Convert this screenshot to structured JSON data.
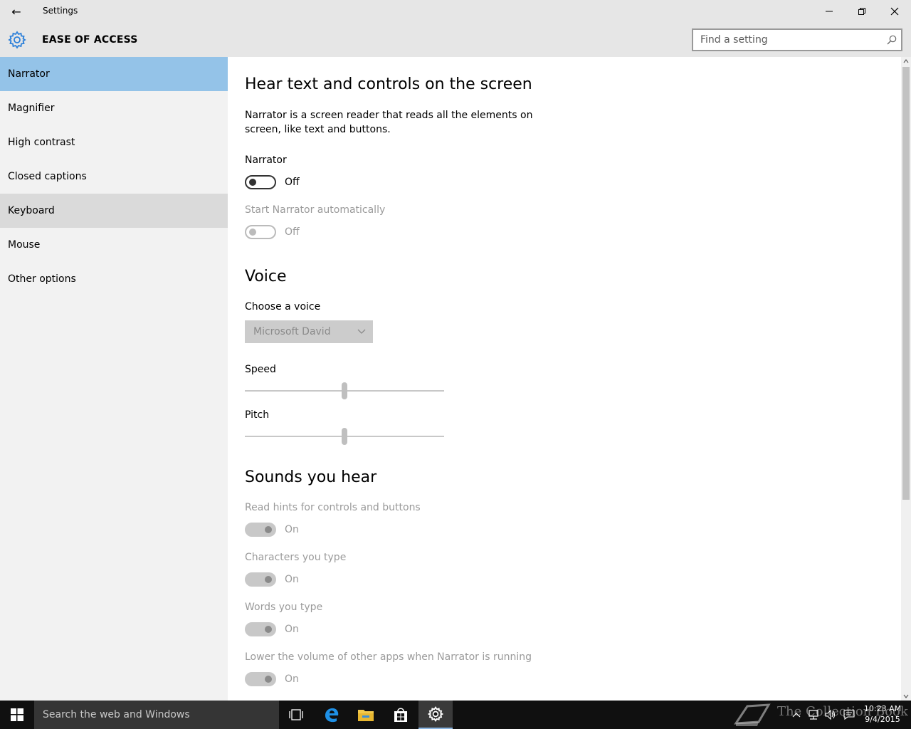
{
  "window": {
    "title": "Settings",
    "back_glyph": "←",
    "controls": {
      "minimize": "minimize-icon",
      "maximize": "restore-icon",
      "close": "close-icon"
    }
  },
  "header": {
    "title": "EASE OF ACCESS",
    "icon": "gear-icon",
    "accent": "#2b7fd9",
    "search_placeholder": "Find a setting"
  },
  "sidebar": {
    "selected_color": "#94c3e8",
    "items": [
      {
        "label": "Narrator",
        "state": "selected"
      },
      {
        "label": "Magnifier",
        "state": "normal"
      },
      {
        "label": "High contrast",
        "state": "normal"
      },
      {
        "label": "Closed captions",
        "state": "normal"
      },
      {
        "label": "Keyboard",
        "state": "hover"
      },
      {
        "label": "Mouse",
        "state": "normal"
      },
      {
        "label": "Other options",
        "state": "normal"
      }
    ]
  },
  "main": {
    "section1": {
      "heading": "Hear text and controls on the screen",
      "description": "Narrator is a screen reader that reads all the elements on screen, like text and buttons.",
      "narrator": {
        "label": "Narrator",
        "value": "Off"
      },
      "auto_start": {
        "label": "Start Narrator automatically",
        "value": "Off"
      }
    },
    "voice": {
      "heading": "Voice",
      "choose_label": "Choose a voice",
      "selected_voice": "Microsoft David",
      "speed": {
        "label": "Speed",
        "level": 0.5
      },
      "pitch": {
        "label": "Pitch",
        "level": 0.5
      }
    },
    "sounds": {
      "heading": "Sounds you hear",
      "items": [
        {
          "label": "Read hints for controls and buttons",
          "value": "On"
        },
        {
          "label": "Characters you type",
          "value": "On"
        },
        {
          "label": "Words you type",
          "value": "On"
        },
        {
          "label": "Lower the volume of other apps when Narrator is running",
          "value": "On"
        }
      ]
    }
  },
  "taskbar": {
    "search_placeholder": "Search the web and Windows",
    "apps": [
      "task-view-icon",
      "edge-icon",
      "file-explorer-icon",
      "store-icon",
      "settings-icon"
    ],
    "watermark": "The Collection Book",
    "time": "10:23 AM",
    "date": "9/4/2015"
  }
}
